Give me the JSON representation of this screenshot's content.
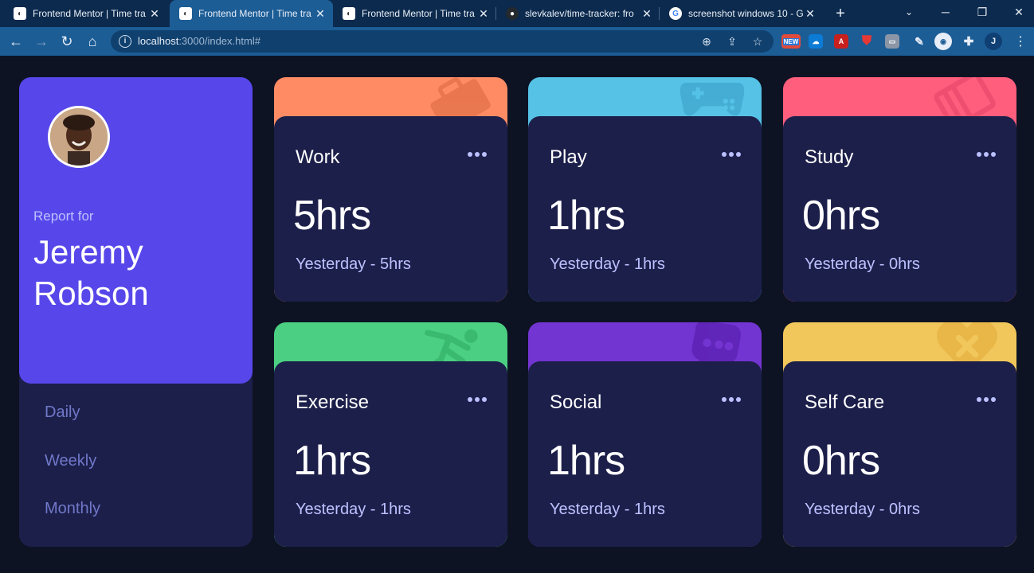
{
  "browser": {
    "tabs": [
      {
        "title": "Frontend Mentor | Time tra",
        "active": false
      },
      {
        "title": "Frontend Mentor | Time tra",
        "active": true
      },
      {
        "title": "Frontend Mentor | Time tra",
        "active": false
      },
      {
        "title": "slevkalev/time-tracker: fro",
        "active": false
      },
      {
        "title": "screenshot windows 10 - G",
        "active": false
      }
    ],
    "url_host": "localhost",
    "url_rest": ":3000/index.html#",
    "extension_badge": "NEW",
    "profile_initial": "J"
  },
  "profile": {
    "report_label": "Report for",
    "name": "Jeremy Robson",
    "periods": [
      "Daily",
      "Weekly",
      "Monthly"
    ]
  },
  "cards": [
    {
      "title": "Work",
      "hours": "5hrs",
      "previous": "Yesterday - 5hrs",
      "color": "#ff8b64",
      "icon": "briefcase-icon"
    },
    {
      "title": "Play",
      "hours": "1hrs",
      "previous": "Yesterday - 1hrs",
      "color": "#55c2e6",
      "icon": "gamepad-icon"
    },
    {
      "title": "Study",
      "hours": "0hrs",
      "previous": "Yesterday - 0hrs",
      "color": "#ff5e7d",
      "icon": "books-icon"
    },
    {
      "title": "Exercise",
      "hours": "1hrs",
      "previous": "Yesterday - 1hrs",
      "color": "#4bcf82",
      "icon": "running-icon"
    },
    {
      "title": "Social",
      "hours": "1hrs",
      "previous": "Yesterday - 1hrs",
      "color": "#7335d2",
      "icon": "chat-icon"
    },
    {
      "title": "Self Care",
      "hours": "0hrs",
      "previous": "Yesterday - 0hrs",
      "color": "#f1c75b",
      "icon": "heart-bandage-icon"
    }
  ]
}
